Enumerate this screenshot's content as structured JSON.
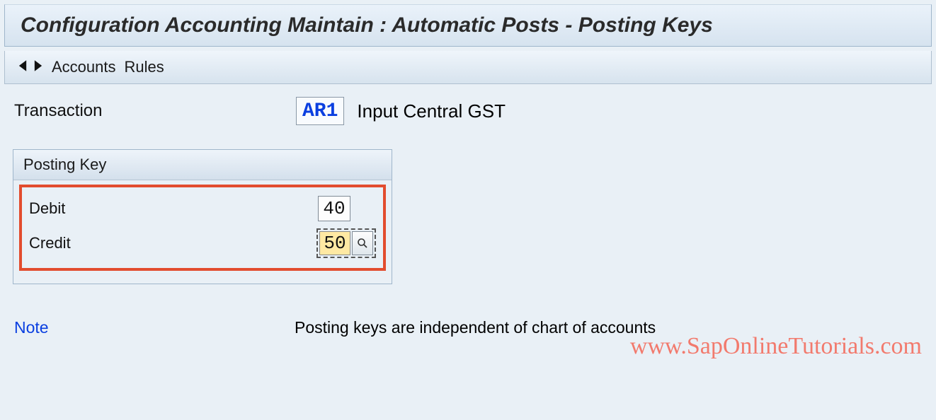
{
  "title": "Configuration Accounting Maintain : Automatic Posts - Posting Keys",
  "toolbar": {
    "accounts_label": "Accounts",
    "rules_label": "Rules"
  },
  "transaction": {
    "label": "Transaction",
    "code": "AR1",
    "description": "Input Central GST"
  },
  "posting_key": {
    "group_title": "Posting Key",
    "debit_label": "Debit",
    "debit_value": "40",
    "credit_label": "Credit",
    "credit_value": "50"
  },
  "note": {
    "label": "Note",
    "text": "Posting keys are independent of chart of accounts"
  },
  "watermark": "www.SapOnlineTutorials.com"
}
